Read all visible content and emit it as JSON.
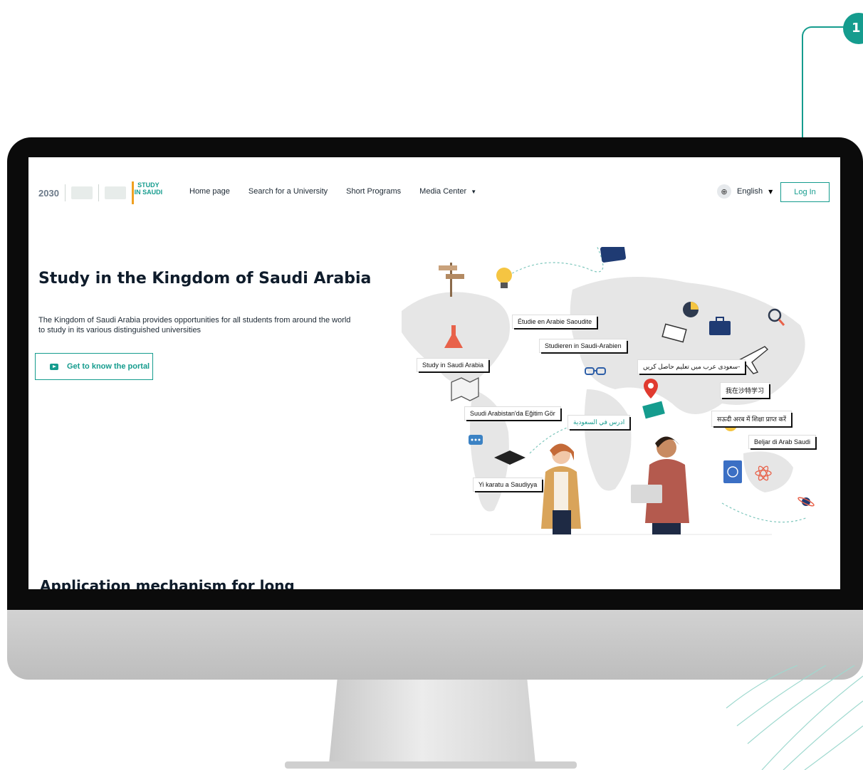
{
  "callout": {
    "number": "1"
  },
  "nav": {
    "logos": {
      "vision": "2030",
      "study_in_saudi": "STUDY IN SAUDI"
    },
    "links": [
      {
        "label": "Home page"
      },
      {
        "label": "Search for a University"
      },
      {
        "label": "Short Programs"
      },
      {
        "label": "Media Center"
      }
    ],
    "language": "English",
    "login": "Log In"
  },
  "hero": {
    "title": "Study in the Kingdom of Saudi Arabia",
    "description": "The Kingdom of Saudi Arabia provides opportunities for all students from around the world to study in its various distinguished universities",
    "cta": "Get to know the portal"
  },
  "section": {
    "title": "Application mechanism for long"
  },
  "illustration": {
    "tags": [
      "Étudie en Arabie Saoudite",
      "Studieren in Saudi-Arabien",
      "Study in Saudi Arabia",
      "سعودی عرب میں تعلیم حاصل کریں-",
      "我在沙特学习",
      "Suudi Arabistan'da Eğitim Gör",
      "ادرس في السعودية",
      "सऊदी अरब में शिक्षा प्राप्त करें",
      "Beljar di Arab Saudi",
      "Yi karatu a Saudiyya"
    ]
  }
}
